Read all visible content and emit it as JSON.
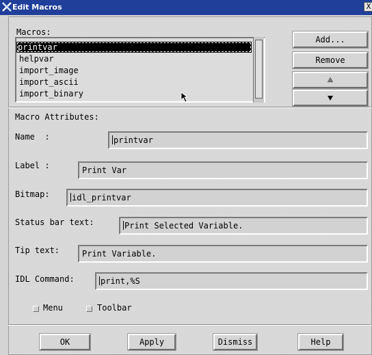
{
  "window": {
    "title": "Edit Macros",
    "close_glyph": "X",
    "app_icon": "x-logo-icon"
  },
  "macros": {
    "label": "Macros:",
    "items": [
      "printvar",
      "helpvar",
      "import_image",
      "import_ascii",
      "import_binary"
    ],
    "selected": "printvar"
  },
  "side_buttons": {
    "add": "Add...",
    "remove": "Remove",
    "up_icon": "triangle-up-icon",
    "down_icon": "triangle-down-icon"
  },
  "attributes": {
    "section_label": "Macro Attributes:",
    "name_label": "Name  :",
    "name_value": "printvar",
    "label_label": "Label :",
    "label_value": "Print Var",
    "bitmap_label": "Bitmap:",
    "bitmap_value": "idl_printvar",
    "status_label": "Status bar text:",
    "status_value": "Print Selected Variable.",
    "tip_label": "Tip text:",
    "tip_value": "Print Variable.",
    "cmd_label": "IDL Command:",
    "cmd_value": "print,%S"
  },
  "options": {
    "menu_label": "Menu",
    "toolbar_label": "Toolbar",
    "menu_checked": false,
    "toolbar_checked": false
  },
  "footer": {
    "ok": "OK",
    "apply": "Apply",
    "dismiss": "Dismiss",
    "help": "Help"
  },
  "colors": {
    "titlebar": "#1f3f9a",
    "panel": "#dedede",
    "selection": "#000000"
  }
}
